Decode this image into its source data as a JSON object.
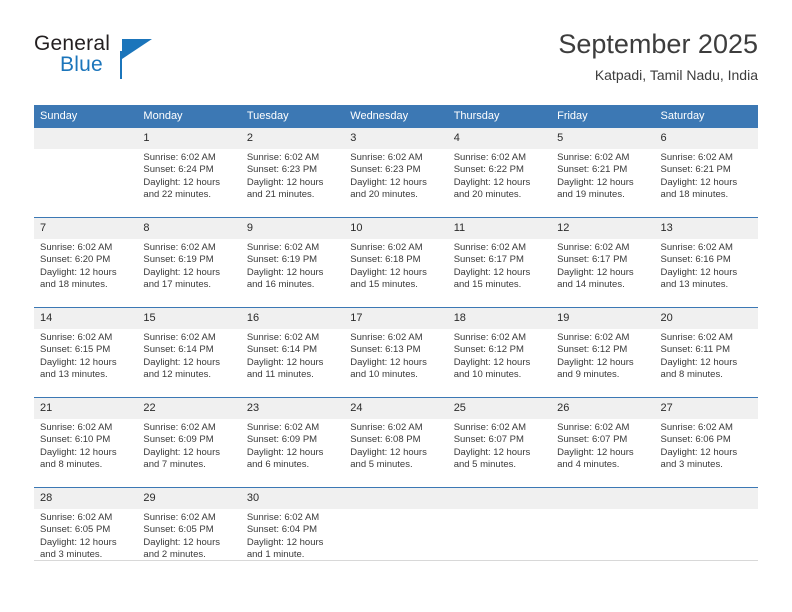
{
  "brand": {
    "name_top": "General",
    "name_bottom": "Blue",
    "triangle_icon": "blue-triangle-logo-mark",
    "accent_color": "#1b75bb"
  },
  "header": {
    "title": "September 2025",
    "subtitle": "Katpadi, Tamil Nadu, India"
  },
  "theme": {
    "header_blue": "#3c78b4",
    "daynum_band": "#f0f0f0",
    "text": "#3a3a3a"
  },
  "calendar": {
    "weekday_headers": [
      "Sunday",
      "Monday",
      "Tuesday",
      "Wednesday",
      "Thursday",
      "Friday",
      "Saturday"
    ],
    "weeks": [
      [
        {
          "day": "",
          "sunrise": "",
          "sunset": "",
          "daylight_line1": "",
          "daylight_line2": ""
        },
        {
          "day": "1",
          "sunrise": "Sunrise: 6:02 AM",
          "sunset": "Sunset: 6:24 PM",
          "daylight_line1": "Daylight: 12 hours",
          "daylight_line2": "and 22 minutes."
        },
        {
          "day": "2",
          "sunrise": "Sunrise: 6:02 AM",
          "sunset": "Sunset: 6:23 PM",
          "daylight_line1": "Daylight: 12 hours",
          "daylight_line2": "and 21 minutes."
        },
        {
          "day": "3",
          "sunrise": "Sunrise: 6:02 AM",
          "sunset": "Sunset: 6:23 PM",
          "daylight_line1": "Daylight: 12 hours",
          "daylight_line2": "and 20 minutes."
        },
        {
          "day": "4",
          "sunrise": "Sunrise: 6:02 AM",
          "sunset": "Sunset: 6:22 PM",
          "daylight_line1": "Daylight: 12 hours",
          "daylight_line2": "and 20 minutes."
        },
        {
          "day": "5",
          "sunrise": "Sunrise: 6:02 AM",
          "sunset": "Sunset: 6:21 PM",
          "daylight_line1": "Daylight: 12 hours",
          "daylight_line2": "and 19 minutes."
        },
        {
          "day": "6",
          "sunrise": "Sunrise: 6:02 AM",
          "sunset": "Sunset: 6:21 PM",
          "daylight_line1": "Daylight: 12 hours",
          "daylight_line2": "and 18 minutes."
        }
      ],
      [
        {
          "day": "7",
          "sunrise": "Sunrise: 6:02 AM",
          "sunset": "Sunset: 6:20 PM",
          "daylight_line1": "Daylight: 12 hours",
          "daylight_line2": "and 18 minutes."
        },
        {
          "day": "8",
          "sunrise": "Sunrise: 6:02 AM",
          "sunset": "Sunset: 6:19 PM",
          "daylight_line1": "Daylight: 12 hours",
          "daylight_line2": "and 17 minutes."
        },
        {
          "day": "9",
          "sunrise": "Sunrise: 6:02 AM",
          "sunset": "Sunset: 6:19 PM",
          "daylight_line1": "Daylight: 12 hours",
          "daylight_line2": "and 16 minutes."
        },
        {
          "day": "10",
          "sunrise": "Sunrise: 6:02 AM",
          "sunset": "Sunset: 6:18 PM",
          "daylight_line1": "Daylight: 12 hours",
          "daylight_line2": "and 15 minutes."
        },
        {
          "day": "11",
          "sunrise": "Sunrise: 6:02 AM",
          "sunset": "Sunset: 6:17 PM",
          "daylight_line1": "Daylight: 12 hours",
          "daylight_line2": "and 15 minutes."
        },
        {
          "day": "12",
          "sunrise": "Sunrise: 6:02 AM",
          "sunset": "Sunset: 6:17 PM",
          "daylight_line1": "Daylight: 12 hours",
          "daylight_line2": "and 14 minutes."
        },
        {
          "day": "13",
          "sunrise": "Sunrise: 6:02 AM",
          "sunset": "Sunset: 6:16 PM",
          "daylight_line1": "Daylight: 12 hours",
          "daylight_line2": "and 13 minutes."
        }
      ],
      [
        {
          "day": "14",
          "sunrise": "Sunrise: 6:02 AM",
          "sunset": "Sunset: 6:15 PM",
          "daylight_line1": "Daylight: 12 hours",
          "daylight_line2": "and 13 minutes."
        },
        {
          "day": "15",
          "sunrise": "Sunrise: 6:02 AM",
          "sunset": "Sunset: 6:14 PM",
          "daylight_line1": "Daylight: 12 hours",
          "daylight_line2": "and 12 minutes."
        },
        {
          "day": "16",
          "sunrise": "Sunrise: 6:02 AM",
          "sunset": "Sunset: 6:14 PM",
          "daylight_line1": "Daylight: 12 hours",
          "daylight_line2": "and 11 minutes."
        },
        {
          "day": "17",
          "sunrise": "Sunrise: 6:02 AM",
          "sunset": "Sunset: 6:13 PM",
          "daylight_line1": "Daylight: 12 hours",
          "daylight_line2": "and 10 minutes."
        },
        {
          "day": "18",
          "sunrise": "Sunrise: 6:02 AM",
          "sunset": "Sunset: 6:12 PM",
          "daylight_line1": "Daylight: 12 hours",
          "daylight_line2": "and 10 minutes."
        },
        {
          "day": "19",
          "sunrise": "Sunrise: 6:02 AM",
          "sunset": "Sunset: 6:12 PM",
          "daylight_line1": "Daylight: 12 hours",
          "daylight_line2": "and 9 minutes."
        },
        {
          "day": "20",
          "sunrise": "Sunrise: 6:02 AM",
          "sunset": "Sunset: 6:11 PM",
          "daylight_line1": "Daylight: 12 hours",
          "daylight_line2": "and 8 minutes."
        }
      ],
      [
        {
          "day": "21",
          "sunrise": "Sunrise: 6:02 AM",
          "sunset": "Sunset: 6:10 PM",
          "daylight_line1": "Daylight: 12 hours",
          "daylight_line2": "and 8 minutes."
        },
        {
          "day": "22",
          "sunrise": "Sunrise: 6:02 AM",
          "sunset": "Sunset: 6:09 PM",
          "daylight_line1": "Daylight: 12 hours",
          "daylight_line2": "and 7 minutes."
        },
        {
          "day": "23",
          "sunrise": "Sunrise: 6:02 AM",
          "sunset": "Sunset: 6:09 PM",
          "daylight_line1": "Daylight: 12 hours",
          "daylight_line2": "and 6 minutes."
        },
        {
          "day": "24",
          "sunrise": "Sunrise: 6:02 AM",
          "sunset": "Sunset: 6:08 PM",
          "daylight_line1": "Daylight: 12 hours",
          "daylight_line2": "and 5 minutes."
        },
        {
          "day": "25",
          "sunrise": "Sunrise: 6:02 AM",
          "sunset": "Sunset: 6:07 PM",
          "daylight_line1": "Daylight: 12 hours",
          "daylight_line2": "and 5 minutes."
        },
        {
          "day": "26",
          "sunrise": "Sunrise: 6:02 AM",
          "sunset": "Sunset: 6:07 PM",
          "daylight_line1": "Daylight: 12 hours",
          "daylight_line2": "and 4 minutes."
        },
        {
          "day": "27",
          "sunrise": "Sunrise: 6:02 AM",
          "sunset": "Sunset: 6:06 PM",
          "daylight_line1": "Daylight: 12 hours",
          "daylight_line2": "and 3 minutes."
        }
      ],
      [
        {
          "day": "28",
          "sunrise": "Sunrise: 6:02 AM",
          "sunset": "Sunset: 6:05 PM",
          "daylight_line1": "Daylight: 12 hours",
          "daylight_line2": "and 3 minutes."
        },
        {
          "day": "29",
          "sunrise": "Sunrise: 6:02 AM",
          "sunset": "Sunset: 6:05 PM",
          "daylight_line1": "Daylight: 12 hours",
          "daylight_line2": "and 2 minutes."
        },
        {
          "day": "30",
          "sunrise": "Sunrise: 6:02 AM",
          "sunset": "Sunset: 6:04 PM",
          "daylight_line1": "Daylight: 12 hours",
          "daylight_line2": "and 1 minute."
        },
        {
          "day": "",
          "sunrise": "",
          "sunset": "",
          "daylight_line1": "",
          "daylight_line2": ""
        },
        {
          "day": "",
          "sunrise": "",
          "sunset": "",
          "daylight_line1": "",
          "daylight_line2": ""
        },
        {
          "day": "",
          "sunrise": "",
          "sunset": "",
          "daylight_line1": "",
          "daylight_line2": ""
        },
        {
          "day": "",
          "sunrise": "",
          "sunset": "",
          "daylight_line1": "",
          "daylight_line2": ""
        }
      ]
    ]
  }
}
